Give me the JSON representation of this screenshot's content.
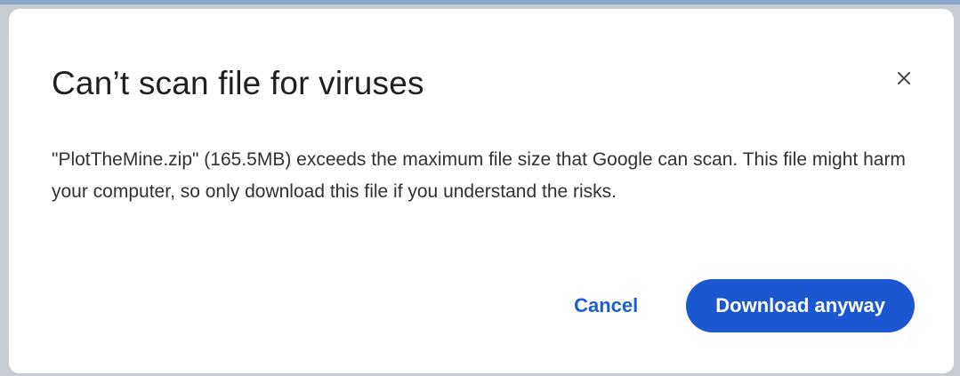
{
  "dialog": {
    "title": "Can’t scan file for viruses",
    "message": "\"PlotTheMine.zip\" (165.5MB) exceeds the maximum file size that Google can scan. This file might harm your computer, so only download this file if you understand the risks.",
    "close_icon": "close-icon",
    "cancel_label": "Cancel",
    "download_label": "Download anyway"
  },
  "colors": {
    "accent": "#1a57d1",
    "link": "#1b5fcf",
    "title_text": "#1f1f1f",
    "body_text": "#303134"
  }
}
